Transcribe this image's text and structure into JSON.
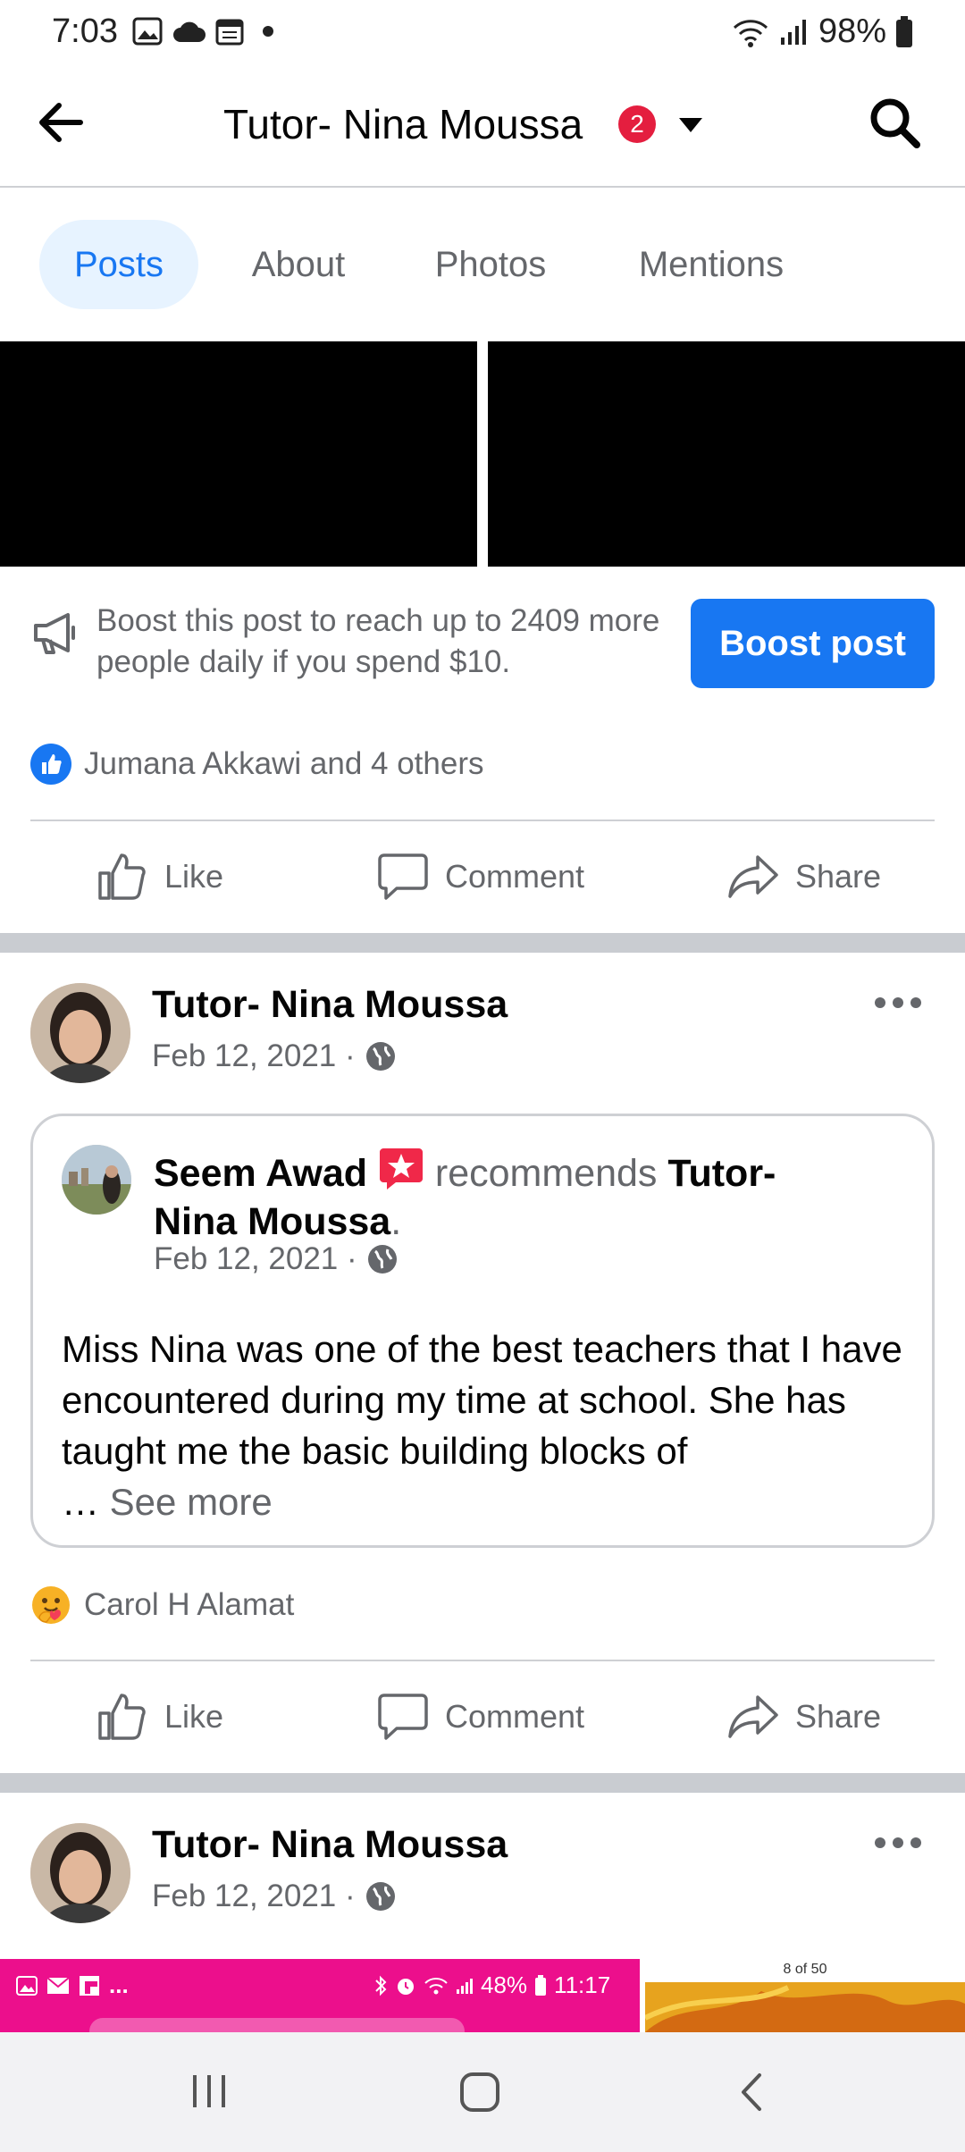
{
  "status_bar": {
    "time": "7:03",
    "battery": "98%",
    "icons": [
      "gallery-icon",
      "cloud-icon",
      "calendar-icon",
      "dot-icon",
      "wifi-icon",
      "signal-icon",
      "battery-icon"
    ]
  },
  "header": {
    "title": "Tutor- Nina Moussa",
    "badge_count": "2",
    "icons": [
      "back-arrow-icon",
      "dropdown-caret-icon",
      "search-icon"
    ]
  },
  "tabs": [
    {
      "label": "Posts",
      "active": true
    },
    {
      "label": "About",
      "active": false
    },
    {
      "label": "Photos",
      "active": false
    },
    {
      "label": "Mentions",
      "active": false
    }
  ],
  "boost": {
    "text": "Boost this post to reach up to 2409 more people daily if you spend $10.",
    "button_label": "Boost post"
  },
  "post1": {
    "reactions_text": "Jumana Akkawi and 4 others"
  },
  "actions": {
    "like": "Like",
    "comment": "Comment",
    "share": "Share"
  },
  "post2": {
    "author": "Tutor- Nina Moussa",
    "date": "Feb 12, 2021 ·",
    "recommendation": {
      "author": "Seem Awad",
      "verb": "recommends",
      "page_line1": "Tutor-",
      "page_line2": "Nina Moussa",
      "period": ".",
      "date": "Feb 12, 2021 ·",
      "body": "Miss Nina was one of the best teachers that I have encountered during my time at school. She has taught me the basic building blocks of",
      "ellipsis": "…",
      "see_more": "See more"
    },
    "reactions_text": "Carol H Alamat"
  },
  "post3": {
    "author": "Tutor- Nina Moussa",
    "date": "Feb 12, 2021 ·"
  },
  "overlay": {
    "pink_status": "48%",
    "pink_time": "11:17",
    "page_counter": "8 of 50"
  },
  "colors": {
    "accent": "#1877f2",
    "text_secondary": "#65676b",
    "separator": "#c9ccd1",
    "badge": "#e41e3f",
    "overlay_pink": "#ec0f8c"
  }
}
